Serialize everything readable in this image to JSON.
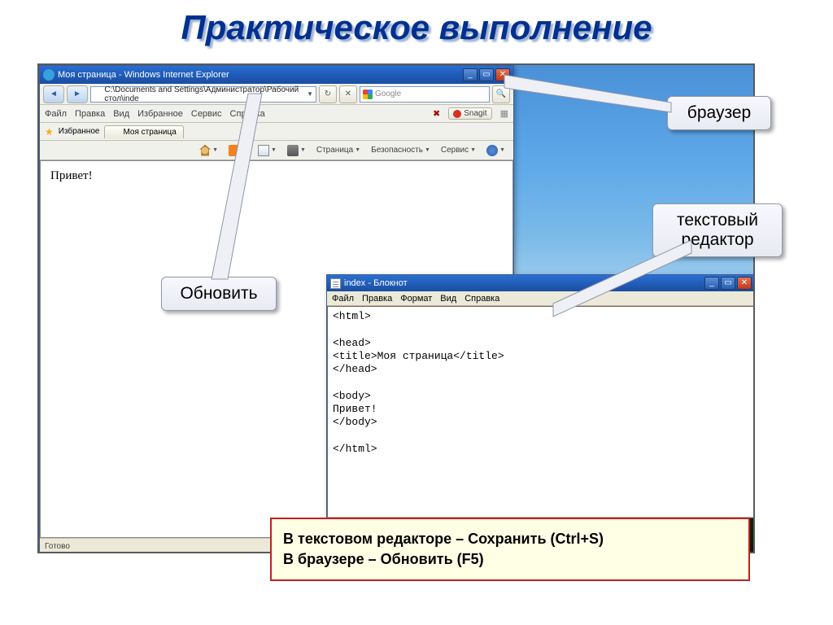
{
  "slide": {
    "title": "Практическое выполнение"
  },
  "browser": {
    "title": "Моя страница - Windows Internet Explorer",
    "address": "C:\\Documents and Settings\\Администратор\\Рабочий стол\\inde",
    "search_placeholder": "Google",
    "menu": [
      "Файл",
      "Правка",
      "Вид",
      "Избранное",
      "Сервис",
      "Справка"
    ],
    "snagit": "Snagit",
    "favorites_label": "Избранное",
    "tab_title": "Моя страница",
    "toolbar": {
      "page": "Страница",
      "safety": "Безопасность",
      "tools": "Сервис"
    },
    "page_text": "Привет!",
    "status": "Готово"
  },
  "notepad": {
    "title": "index - Блокнот",
    "menu": [
      "Файл",
      "Правка",
      "Формат",
      "Вид",
      "Справка"
    ],
    "lines": [
      "<html>",
      "",
      "<head>",
      "<title>Моя страница</title>",
      "</head>",
      "",
      "<body>",
      "Привет!",
      "</body>",
      "",
      "</html>"
    ]
  },
  "callouts": {
    "refresh": "Обновить",
    "browser": "браузер",
    "editor": "текстовый редактор"
  },
  "instructions": {
    "line1": "В текстовом редакторе – Сохранить (Ctrl+S)",
    "line2": "В браузере – Обновить (F5)"
  }
}
